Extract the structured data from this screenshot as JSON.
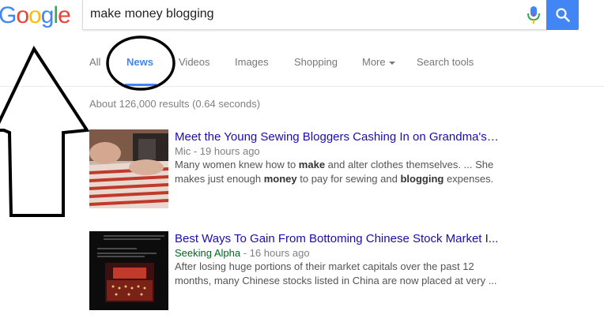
{
  "logo": {
    "text": "Google",
    "letters": [
      "G",
      "o",
      "o",
      "g",
      "l",
      "e"
    ],
    "colors": [
      "#4285f4",
      "#ea4335",
      "#fbbc05",
      "#4285f4",
      "#34a853",
      "#ea4335"
    ]
  },
  "search": {
    "query": "make money blogging",
    "mic_icon": "mic-icon",
    "button_icon": "search-icon"
  },
  "tabs": [
    {
      "label": "All",
      "active": false
    },
    {
      "label": "News",
      "active": true
    },
    {
      "label": "Videos",
      "active": false
    },
    {
      "label": "Images",
      "active": false
    },
    {
      "label": "Shopping",
      "active": false
    },
    {
      "label": "More",
      "active": false
    },
    {
      "label": "Search tools",
      "active": false
    }
  ],
  "stats": "About 126,000 results (0.64 seconds)",
  "results": [
    {
      "title": "Meet the Young Sewing Bloggers Cashing In on Grandma's ...",
      "source": "Mic",
      "source_color": "#808080",
      "time": " - 19 hours ago",
      "snippet_parts": [
        "Many women knew how to ",
        "make",
        " and alter clothes themselves. ... She makes just enough ",
        "money",
        " to pay for sewing and ",
        "blogging",
        " expenses."
      ]
    },
    {
      "title": "Best Ways To Gain From Bottoming Chinese Stock Market I...",
      "source": "Seeking Alpha",
      "source_color": "#006621",
      "time": " - 16 hours ago",
      "snippet_parts": [
        "After losing huge portions of their market capitals over the past 12 months, many Chinese stocks listed in China are now placed at very ..."
      ]
    }
  ],
  "annotations": {
    "arrow": "up-arrow-annotation",
    "circle": "circle-annotation"
  },
  "colors": {
    "accent": "#4285f4",
    "link": "#1a0dab"
  }
}
